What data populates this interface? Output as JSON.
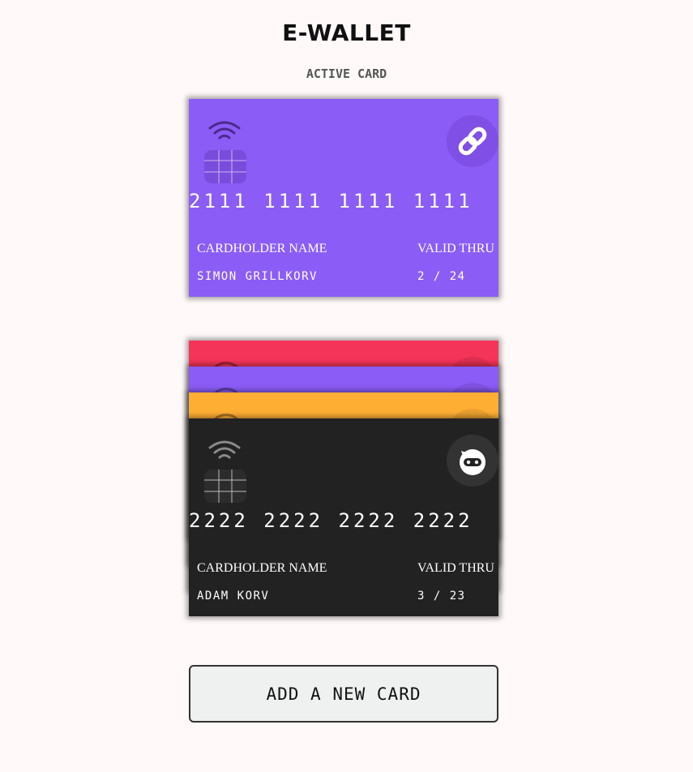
{
  "header": {
    "title": "E-WALLET",
    "subtitle": "ACTIVE CARD"
  },
  "active_card": {
    "number": "2111 1111 1111 1111",
    "holder_label": "CARDHOLDER NAME",
    "holder_name": "SIMON GRILLKORV",
    "valid_label": "VALID THRU",
    "valid_value": "2 / 24",
    "color": "#8b5cf6",
    "logo_icon": "chain-link-icon"
  },
  "card_stack": [
    {
      "color": "#f43458"
    },
    {
      "color": "#8b5cf6"
    },
    {
      "color": "#ffae34"
    }
  ],
  "front_stack_card": {
    "number": "2222 2222 2222 2222",
    "holder_label": "CARDHOLDER NAME",
    "holder_name": "ADAM KORV",
    "valid_label": "VALID THRU",
    "valid_value": "3 / 23",
    "color": "#222222",
    "logo_icon": "ninja-icon"
  },
  "add_button": {
    "label": "ADD A NEW CARD"
  }
}
